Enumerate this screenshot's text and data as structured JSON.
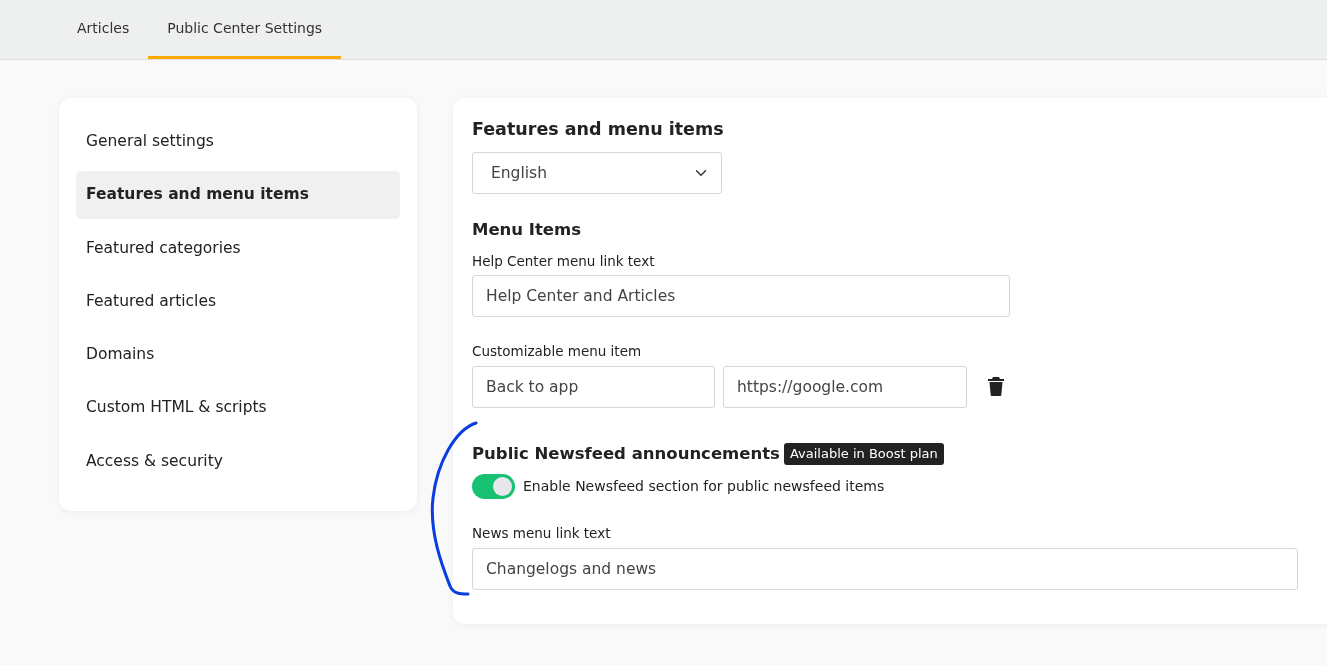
{
  "tabs": [
    {
      "label": "Articles",
      "selected": false
    },
    {
      "label": "Public Center Settings",
      "selected": true
    }
  ],
  "sidebar": {
    "items": [
      {
        "label": "General settings",
        "selected": false
      },
      {
        "label": "Features and menu items",
        "selected": true
      },
      {
        "label": "Featured categories",
        "selected": false
      },
      {
        "label": "Featured articles",
        "selected": false
      },
      {
        "label": "Domains",
        "selected": false
      },
      {
        "label": "Custom HTML & scripts",
        "selected": false
      },
      {
        "label": "Access & security",
        "selected": false
      }
    ]
  },
  "panel": {
    "title": "Features and menu items",
    "language_select": {
      "value": "English"
    },
    "menu_items": {
      "heading": "Menu Items",
      "help_center_label": "Help Center menu link text",
      "help_center_value": "Help Center and Articles",
      "custom_label": "Customizable menu item",
      "custom_text_value": "Back to app",
      "custom_url_value": "https://google.com"
    },
    "newsfeed": {
      "heading": "Public Newsfeed announcements",
      "badge": "Available in Boost plan",
      "toggle": {
        "label": "Enable Newsfeed section for public newsfeed items",
        "on": true
      },
      "news_label": "News menu link text",
      "news_value": "Changelogs and news"
    }
  }
}
